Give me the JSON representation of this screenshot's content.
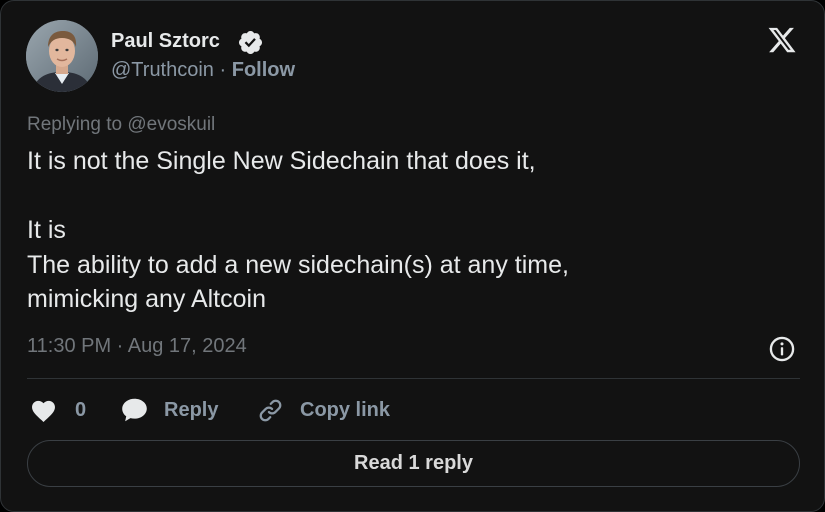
{
  "author": {
    "name": "Paul Sztorc",
    "handle": "@Truthcoin",
    "separator": "·",
    "follow_label": "Follow"
  },
  "tweet": {
    "replying_to": "Replying to @evoskuil",
    "lines": [
      "It is not the Single New Sidechain that does it,",
      "",
      "It is",
      "The ability to add a new sidechain(s) at any time,",
      "mimicking any Altcoin"
    ],
    "timestamp": "11:30 PM · Aug 17, 2024"
  },
  "actions": {
    "like_count": "0",
    "reply_label": "Reply",
    "copy_link_label": "Copy link"
  },
  "read_replies_label": "Read 1 reply",
  "icons": {
    "brand": "x-logo-icon",
    "verified": "verified-badge-icon",
    "info": "info-icon",
    "like": "heart-icon",
    "reply": "speech-bubble-icon",
    "copy": "link-icon"
  },
  "colors": {
    "background": "#121212",
    "primary_text": "#e7e9ea",
    "secondary_text": "#8b98a5",
    "border": "#2f3336"
  }
}
